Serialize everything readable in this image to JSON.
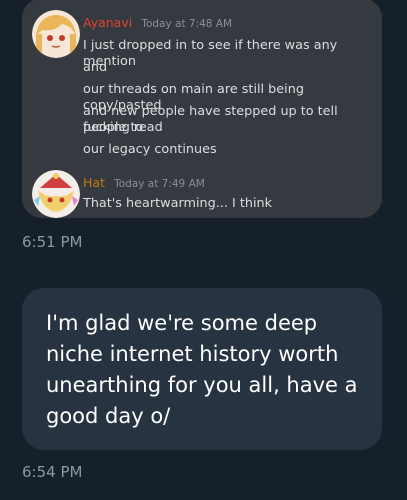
{
  "discord_screenshot": {
    "messages": [
      {
        "author": "Ayanavi",
        "author_color": "#e0432f",
        "time": "Today at 7:48 AM",
        "lines": [
          "I just dropped in to see if there was any mention",
          "and",
          "our threads on main are still being copy/pasted",
          "and new people have stepped up to tell people to",
          "fucking read",
          "our legacy continues"
        ]
      },
      {
        "author": "Hat",
        "author_color": "#c27c0e",
        "time": "Today at 7:49 AM",
        "lines": [
          "That's heartwarming... I think"
        ]
      }
    ]
  },
  "dm": {
    "first_timestamp": "6:51 PM",
    "reply_text_lines": [
      "I'm glad we're some deep",
      "niche internet history worth",
      "unearthing for you all, have a",
      "good day o/"
    ],
    "second_timestamp": "6:54 PM"
  },
  "colors": {
    "background": "#15202b",
    "image_bubble": "#353a40",
    "reply_bubble": "#273340",
    "timestamp": "#8b98a5"
  }
}
